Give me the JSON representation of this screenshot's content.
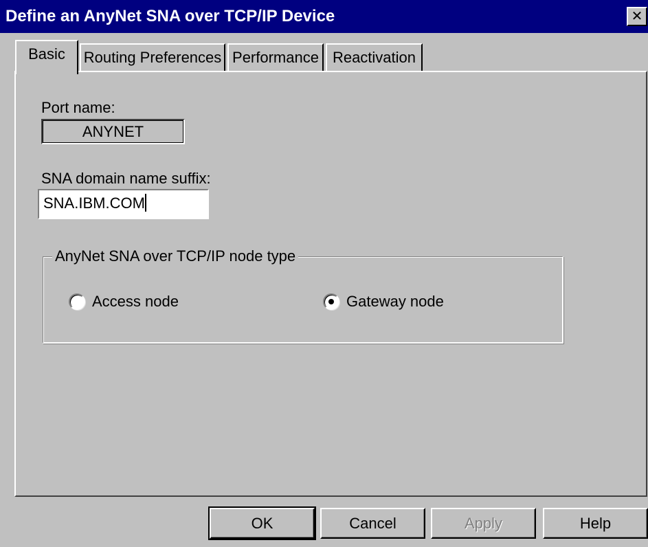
{
  "window": {
    "title": "Define an AnyNet SNA over TCP/IP Device",
    "close_glyph": "✕",
    "close_icon": "close-icon"
  },
  "tabs": [
    {
      "label": "Basic",
      "active": true
    },
    {
      "label": "Routing Preferences",
      "active": false
    },
    {
      "label": "Performance",
      "active": false
    },
    {
      "label": "Reactivation",
      "active": false
    }
  ],
  "basic": {
    "port_name_label": "Port name:",
    "port_name_value": "ANYNET",
    "domain_suffix_label": "SNA domain name suffix:",
    "domain_suffix_value": "SNA.IBM.COM",
    "node_type_group_label": "AnyNet SNA over TCP/IP node type",
    "node_type_options": [
      {
        "label": "Access node",
        "selected": false
      },
      {
        "label": "Gateway node",
        "selected": true
      }
    ]
  },
  "buttons": {
    "ok": "OK",
    "cancel": "Cancel",
    "apply": "Apply",
    "help": "Help"
  },
  "colors": {
    "titlebar": "#000080",
    "face": "#c0c0c0"
  }
}
